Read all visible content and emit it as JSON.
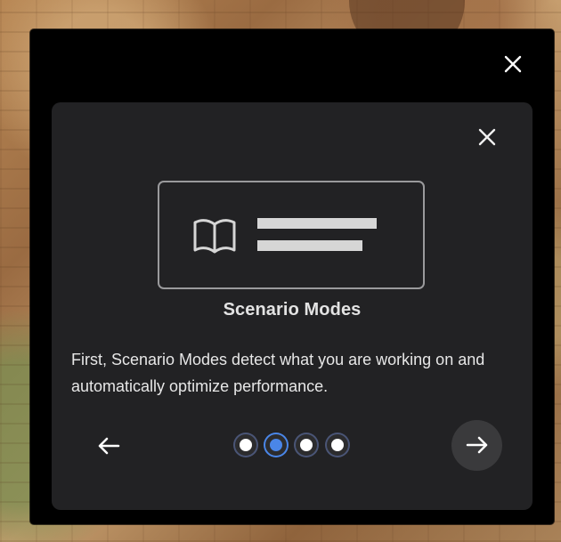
{
  "dialog": {
    "title": "Scenario Modes",
    "description": "First, Scenario Modes detect what you are working on and automatically optimize performance."
  },
  "controls": {
    "outer_close_icon": "close-icon",
    "inner_close_icon": "close-icon",
    "back_icon": "arrow-left-icon",
    "next_icon": "arrow-right-icon"
  },
  "pagination": {
    "total": 4,
    "active_index": 2
  },
  "illustration": {
    "icon": "book-icon",
    "lines": 2
  },
  "colors": {
    "background": "#000000",
    "card": "#222224",
    "accent": "#4a86e8",
    "text": "#e3e3e3"
  }
}
